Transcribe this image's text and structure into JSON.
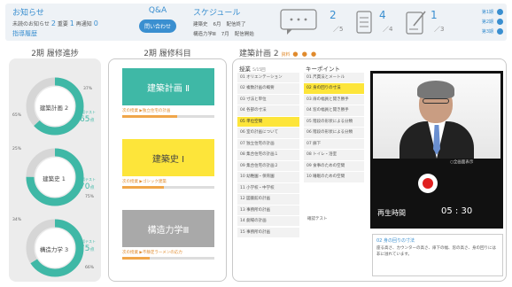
{
  "header": {
    "news": {
      "title": "お知らせ",
      "all_label": "未読のお知らせ",
      "all_count": "2",
      "imp_label": "重要",
      "imp_count": "1",
      "sub_label": "再通知",
      "sub_count": "0",
      "link": "指導履歴"
    },
    "qa": {
      "title": "Q&A",
      "button": "問い合わせ"
    },
    "schedule": {
      "title": "スケジュール",
      "rows": [
        {
          "subject": "建築史",
          "date": "6月",
          "status": "配信終了"
        },
        {
          "subject": "構造力学Ⅲ",
          "date": "7月",
          "status": "配信開始"
        }
      ]
    },
    "stats": [
      {
        "icon": "chat-icon",
        "value": "2",
        "total": "／5"
      },
      {
        "icon": "document-icon",
        "value": "4",
        "total": "／4"
      },
      {
        "icon": "edit-icon",
        "value": "1",
        "total": "／3"
      }
    ],
    "terms": [
      "第1期",
      "第2期",
      "第3期"
    ],
    "accent": "#3a8fd0"
  },
  "progress": {
    "title": "2期 履修進捗",
    "items": [
      {
        "name": "建築計画 2",
        "pct_top": "37%",
        "pct_side": "65%",
        "score_label": "確認テスト",
        "score": "65",
        "unit": "点",
        "value": 0.63
      },
      {
        "name": "建築史 1",
        "pct_top": "25%",
        "pct_side": "75%",
        "score_label": "確認テスト",
        "score": "70",
        "unit": "点",
        "value": 0.75
      },
      {
        "name": "構造力学 3",
        "pct_top": "34%",
        "pct_side": "66%",
        "score_label": "確認テスト",
        "score": "75",
        "unit": "点",
        "value": 0.66
      }
    ],
    "ring_color": "#3fb8a6"
  },
  "courses": {
    "title": "2期 履修科目",
    "items": [
      {
        "name": "建築計画 Ⅱ",
        "next": "次の授業",
        "next_title": "独立住宅の計画",
        "color": "#3fb8a6",
        "text": "#ffffff",
        "progress": 0.6
      },
      {
        "name": "建築史 Ⅰ",
        "next": "次の授業",
        "next_title": "ゴシック建築",
        "color": "#fde53a",
        "text": "#444444",
        "progress": 0.45
      },
      {
        "name": "構造力学Ⅲ",
        "next": "次の授業",
        "next_title": "不静定ラーメンの応力",
        "color": "#a9a9a9",
        "text": "#ffffff",
        "progress": 0.3
      }
    ]
  },
  "lecture": {
    "title": "建築計画 2",
    "sub": "資料",
    "dots": "● ● ●",
    "chapters_head": "授業",
    "chapters_count": "5/15回",
    "chapters": [
      "01 オリエンテーション",
      "02 複数計画の概要",
      "03 寸法と単位",
      "04 各部の寸法",
      "05 単位空間",
      "06 室の計画について",
      "07 独立住宅の計画",
      "08 集合住宅の計画１",
      "09 集合住宅の計画２",
      "10 幼稚園・保育園",
      "11 小学校・中学校",
      "12 図書館の計画",
      "13 事務所の計画",
      "14 劇場の計画",
      "15 事務所の計画"
    ],
    "active_chapter": 4,
    "kp_head": "キーポイント",
    "keypoints": [
      "01 尺貫法とメートル",
      "02 身の回りの寸法",
      "03 扉の幅員と開き勝手",
      "04 窓の幅員と開き勝手",
      "05 階段の形状による分類",
      "06 階段の形状による分類",
      "07 廊下",
      "08 トイレ・浴室",
      "09 食事のための空間",
      "10 睡眠のための空間"
    ],
    "active_keypoint": 1,
    "kp_extra": "確認テスト",
    "video": {
      "fullscreen": "○全画面表示",
      "play_label": "再生時間",
      "time": "05 : 30"
    },
    "note": {
      "title": "02 身の回りの寸法",
      "body": "座る高さ、カウンターの高さ、扉下の幅、窓の高さ、身の回りには非に溢れています。"
    }
  }
}
